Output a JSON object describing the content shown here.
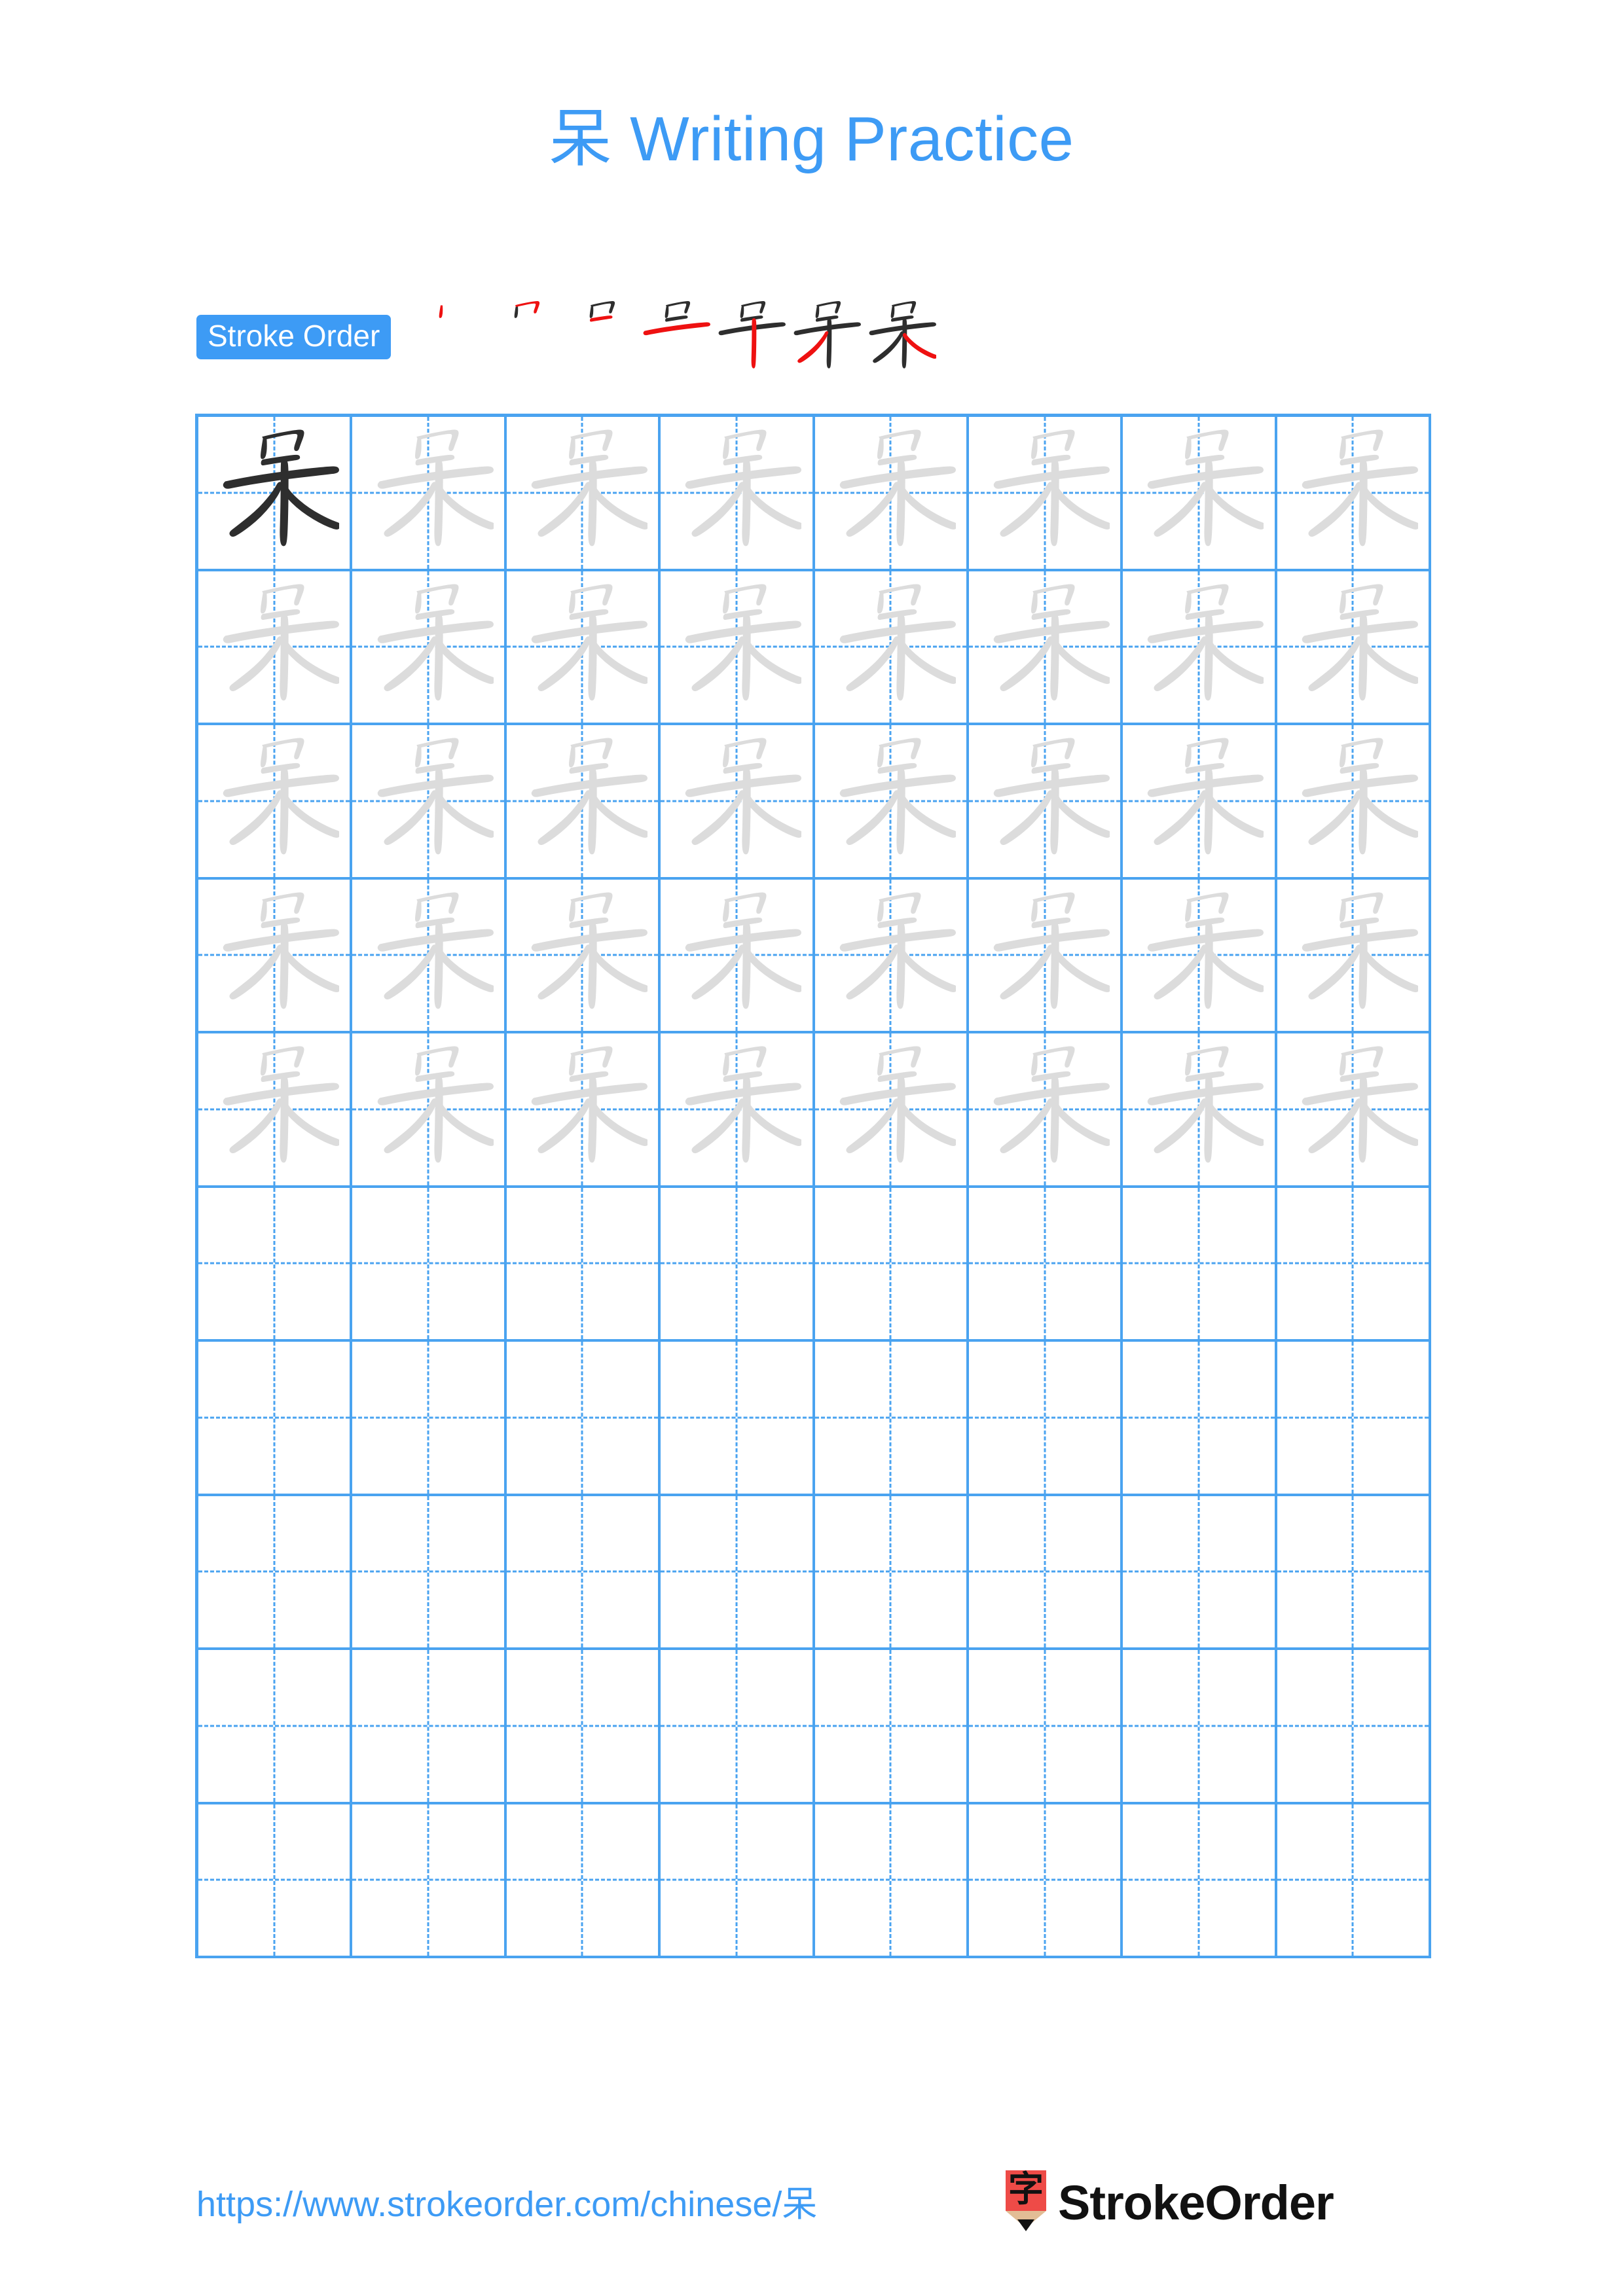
{
  "page": {
    "character": "呆",
    "title": "呆 Writing Practice",
    "title_suffix": "Writing Practice",
    "background_color": "#ffffff"
  },
  "colors": {
    "accent_blue": "#3d9bf5",
    "grid_blue": "#4aa3f0",
    "trace_gray": "#dcdcdc",
    "ink_black": "#2e2e2e",
    "new_stroke_red": "#ee1111",
    "brand_red": "#ee4b47",
    "pencil_wood": "#e2bd95"
  },
  "stroke_order": {
    "badge_label": "Stroke Order",
    "total_strokes": 7,
    "steps": [
      {
        "index": 1,
        "strokes_shown": 1,
        "new_stroke_color": "#ee1111"
      },
      {
        "index": 2,
        "strokes_shown": 2,
        "new_stroke_color": "#ee1111"
      },
      {
        "index": 3,
        "strokes_shown": 3,
        "new_stroke_color": "#ee1111"
      },
      {
        "index": 4,
        "strokes_shown": 4,
        "new_stroke_color": "#ee1111"
      },
      {
        "index": 5,
        "strokes_shown": 5,
        "new_stroke_color": "#ee1111"
      },
      {
        "index": 6,
        "strokes_shown": 6,
        "new_stroke_color": "#ee1111"
      },
      {
        "index": 7,
        "strokes_shown": 7,
        "new_stroke_color": "#ee1111"
      }
    ]
  },
  "practice_grid": {
    "columns": 8,
    "rows": 10,
    "filled_rows": 5,
    "empty_rows": 5,
    "cells": [
      [
        "dark",
        "light",
        "light",
        "light",
        "light",
        "light",
        "light",
        "light"
      ],
      [
        "light",
        "light",
        "light",
        "light",
        "light",
        "light",
        "light",
        "light"
      ],
      [
        "light",
        "light",
        "light",
        "light",
        "light",
        "light",
        "light",
        "light"
      ],
      [
        "light",
        "light",
        "light",
        "light",
        "light",
        "light",
        "light",
        "light"
      ],
      [
        "light",
        "light",
        "light",
        "light",
        "light",
        "light",
        "light",
        "light"
      ],
      [
        "empty",
        "empty",
        "empty",
        "empty",
        "empty",
        "empty",
        "empty",
        "empty"
      ],
      [
        "empty",
        "empty",
        "empty",
        "empty",
        "empty",
        "empty",
        "empty",
        "empty"
      ],
      [
        "empty",
        "empty",
        "empty",
        "empty",
        "empty",
        "empty",
        "empty",
        "empty"
      ],
      [
        "empty",
        "empty",
        "empty",
        "empty",
        "empty",
        "empty",
        "empty",
        "empty"
      ],
      [
        "empty",
        "empty",
        "empty",
        "empty",
        "empty",
        "empty",
        "empty",
        "empty"
      ]
    ]
  },
  "footer": {
    "url": "https://www.strokeorder.com/chinese/呆",
    "brand_name": "StrokeOrder",
    "logo_character": "字"
  }
}
